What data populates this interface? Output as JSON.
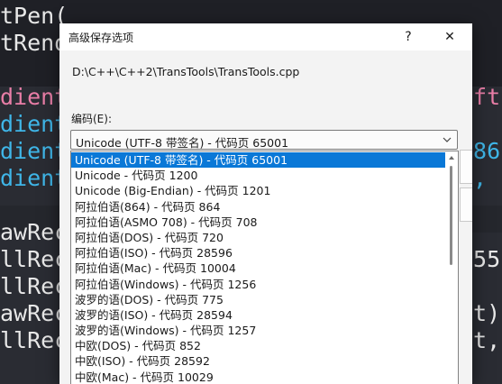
{
  "editor": {
    "lines": [
      {
        "left": "tPen(",
        "right": "",
        "color": "#e8e8e8"
      },
      {
        "left": "tRend",
        "right": "",
        "color": "#e8e8e8"
      },
      {
        "left": "dient",
        "right": "eft",
        "color": "#e97ea7"
      },
      {
        "left": "dient",
        "right": "t",
        "color": "#3fb6e8"
      },
      {
        "left": "dient",
        "right": "186",
        "color": "#3fb6e8"
      },
      {
        "left": "dient",
        "right": "5, ",
        "color": "#3fb6e8"
      },
      {
        "left": "awRec",
        "right": "",
        "color": "#e8e8e8"
      },
      {
        "left": "llRect",
        "right": "255,",
        "color": "#e8e8e8"
      },
      {
        "left": "llRect",
        "right": "",
        "color": "#e8e8e8"
      },
      {
        "left": "awRect",
        "right": "nt);",
        "color": "#e8e8e8"
      },
      {
        "left": "llRect",
        "right": "nt, C",
        "color": "#e8e8e8"
      }
    ]
  },
  "dialog": {
    "title": "高级保存选项",
    "help_label": "?",
    "close_label": "✕",
    "file_path": "D:\\C++\\C++2\\TransTools\\TransTools.cpp",
    "encoding_label": "编码(E):",
    "encoding_value": "Unicode (UTF-8 带签名) - 代码页 65001"
  },
  "dropdown": {
    "selected_index": 0,
    "items": [
      "Unicode (UTF-8 带签名) - 代码页 65001",
      "Unicode - 代码页 1200",
      "Unicode (Big-Endian) - 代码页 1201",
      "阿拉伯语(864) - 代码页 864",
      "阿拉伯语(ASMO 708) - 代码页 708",
      "阿拉伯语(DOS) - 代码页 720",
      "阿拉伯语(ISO) - 代码页 28596",
      "阿拉伯语(Mac) - 代码页 10004",
      "阿拉伯语(Windows) - 代码页 1256",
      "波罗的语(DOS) - 代码页 775",
      "波罗的语(ISO) - 代码页 28594",
      "波罗的语(Windows) - 代码页 1257",
      "中欧(DOS) - 代码页 852",
      "中欧(ISO) - 代码页 28592",
      "中欧(Mac) - 代码页 10029"
    ]
  },
  "colors": {
    "selection": "#0a78d7",
    "editor_bg": "#2a2c33"
  }
}
